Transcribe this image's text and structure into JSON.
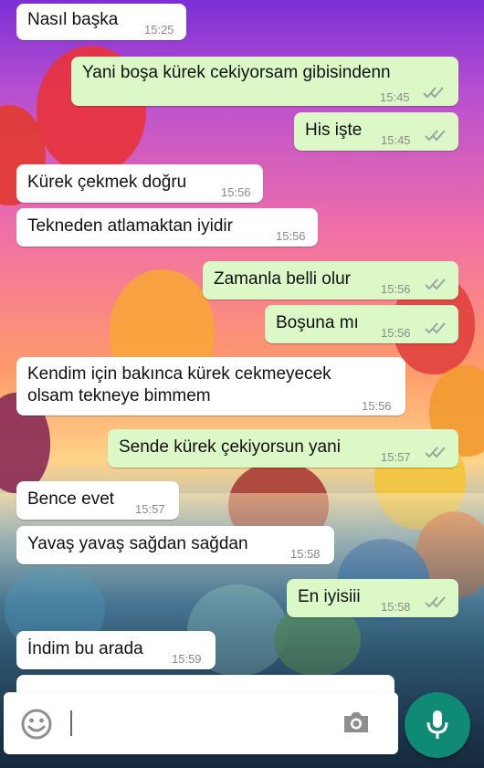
{
  "messages": [
    {
      "text": "Nasıl başka",
      "time": "15:25"
    },
    {
      "text": "Yani boşa kürek cekiyorsam gibisindenn",
      "time": "15:45"
    },
    {
      "text": "His işte",
      "time": "15:45"
    },
    {
      "text": "Kürek çekmek doğru",
      "time": "15:56"
    },
    {
      "text": "Tekneden atlamaktan iyidir",
      "time": "15:56"
    },
    {
      "text": "Zamanla belli olur",
      "time": "15:56"
    },
    {
      "text": "Boşuna mı",
      "time": "15:56"
    },
    {
      "text": "Kendim için bakınca kürek cekmeyecek\nolsam tekneye bimmem",
      "time": "15:56"
    },
    {
      "text": "Sende kürek çekiyorsun yani",
      "time": "15:57"
    },
    {
      "text": "Bence evet",
      "time": "15:57"
    },
    {
      "text": "Yavaş yavaş sağdan sağdan",
      "time": "15:58"
    },
    {
      "text": "En iyisiii",
      "time": "15:58"
    },
    {
      "text": "İndim bu arada",
      "time": "15:59"
    }
  ],
  "composer": {
    "placeholder": ""
  },
  "colors": {
    "incoming": "#ffffff",
    "outgoing": "#dcf8c6",
    "accent": "#0f8a75",
    "tick": "#9aa5a0"
  },
  "icons": {
    "emoji": "smiley-icon",
    "camera": "camera-icon",
    "mic": "microphone-icon",
    "read": "double-check-icon"
  }
}
